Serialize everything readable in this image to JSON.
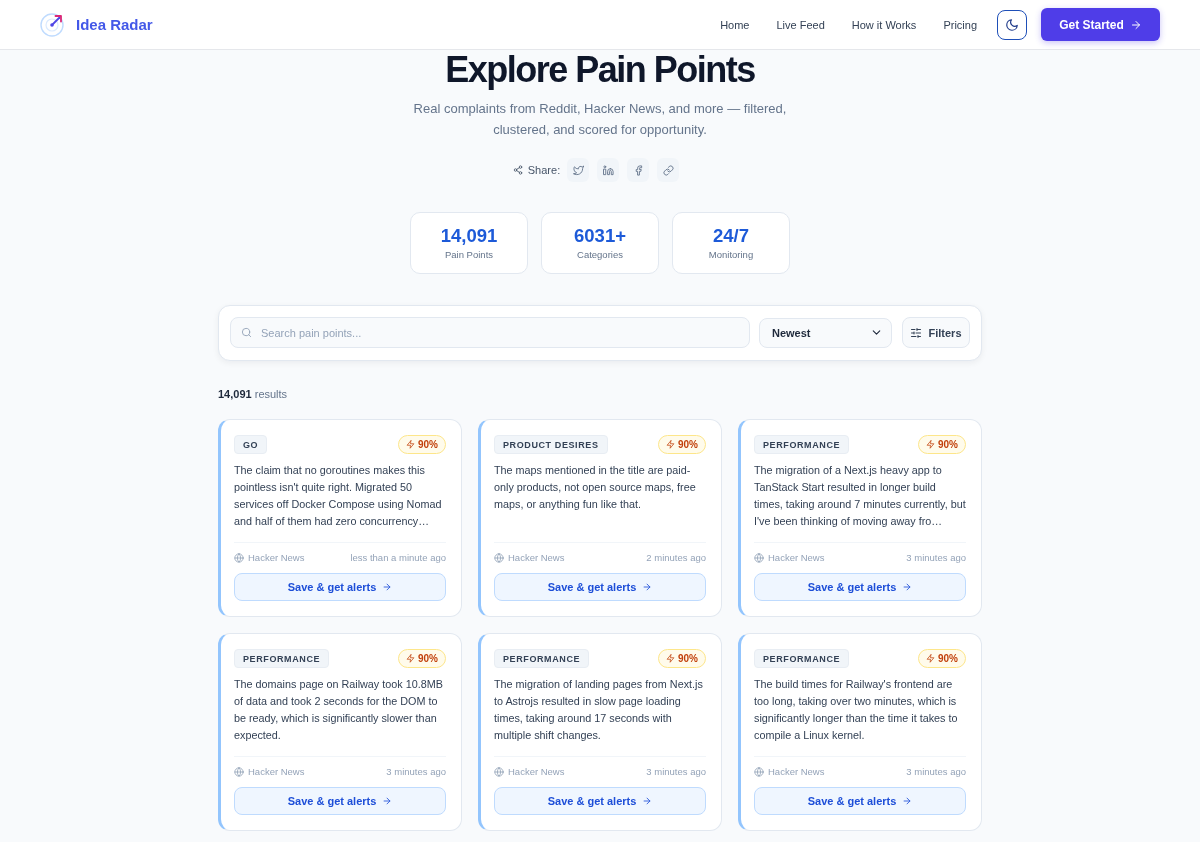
{
  "header": {
    "brand": "Idea Radar",
    "nav": [
      {
        "label": "Home"
      },
      {
        "label": "Live Feed"
      },
      {
        "label": "How it Works"
      },
      {
        "label": "Pricing"
      }
    ],
    "cta": "Get Started"
  },
  "hero": {
    "title": "Explore Pain Points",
    "subtitle": "Real complaints from Reddit, Hacker News, and more — filtered, clustered, and scored for opportunity.",
    "share_label": "Share:"
  },
  "stats": [
    {
      "value": "14,091",
      "label": "Pain Points"
    },
    {
      "value": "6031+",
      "label": "Categories"
    },
    {
      "value": "24/7",
      "label": "Monitoring"
    }
  ],
  "search": {
    "placeholder": "Search pain points...",
    "sort": "Newest",
    "filters": "Filters"
  },
  "results": "**14,091** results",
  "cards": [
    {
      "tag": "GO",
      "score": "90%",
      "text": "The claim that no goroutines makes this pointless isn't quite right. Migrated 50 services off Docker Compose using Nomad and half of them had zero concurrency…",
      "source": "Hacker News",
      "time": "less than a minute ago",
      "action": "Save & get alerts"
    },
    {
      "tag": "PRODUCT DESIRES",
      "score": "90%",
      "text": "The maps mentioned in the title are paid-only products, not open source maps, free maps, or anything fun like that.",
      "source": "Hacker News",
      "time": "2 minutes ago",
      "action": "Save & get alerts"
    },
    {
      "tag": "PERFORMANCE",
      "score": "90%",
      "text": "The migration of a Next.js heavy app to TanStack Start resulted in longer build times, taking around 7 minutes currently, but I've been thinking of moving away fro…",
      "source": "Hacker News",
      "time": "3 minutes ago",
      "action": "Save & get alerts"
    },
    {
      "tag": "PERFORMANCE",
      "score": "90%",
      "text": "The domains page on Railway took 10.8MB of data and took 2 seconds for the DOM to be ready, which is significantly slower than expected.",
      "source": "Hacker News",
      "time": "3 minutes ago",
      "action": "Save & get alerts"
    },
    {
      "tag": "PERFORMANCE",
      "score": "90%",
      "text": "The migration of landing pages from Next.js to Astrojs resulted in slow page loading times, taking around 17 seconds with multiple shift changes.",
      "source": "Hacker News",
      "time": "3 minutes ago",
      "action": "Save & get alerts"
    },
    {
      "tag": "PERFORMANCE",
      "score": "90%",
      "text": "The build times for Railway's frontend are too long, taking over two minutes, which is significantly longer than the time it takes to compile a Linux kernel.",
      "source": "Hacker News",
      "time": "3 minutes ago",
      "action": "Save & get alerts"
    }
  ]
}
